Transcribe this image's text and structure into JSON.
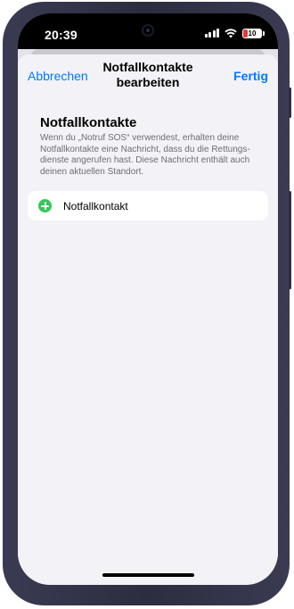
{
  "status_bar": {
    "time": "20:39",
    "battery": "10",
    "icons": [
      "cellular-signal-icon",
      "wifi-icon",
      "battery-icon"
    ],
    "battery_color": "#e53935"
  },
  "nav": {
    "cancel_label": "Abbrechen",
    "title_line1": "Notfallkontakte",
    "title_line2": "bearbeiten",
    "done_label": "Fertig"
  },
  "section": {
    "heading": "Notfallkontakte",
    "description": "Wenn du „Notruf SOS“ verwendest, erhalten deine Notfallkontakte eine Nachricht, dass du die Rettungs­dienste angerufen hast. Diese Nachricht enthält auch deinen aktuellen Standort."
  },
  "add_row": {
    "label": "Notfallkontakt",
    "icon": "add-circle-icon"
  },
  "colors": {
    "accent": "#007aff",
    "add_green": "#34c759",
    "background": "#f2f2f7",
    "secondary_text": "#6d6d72"
  }
}
